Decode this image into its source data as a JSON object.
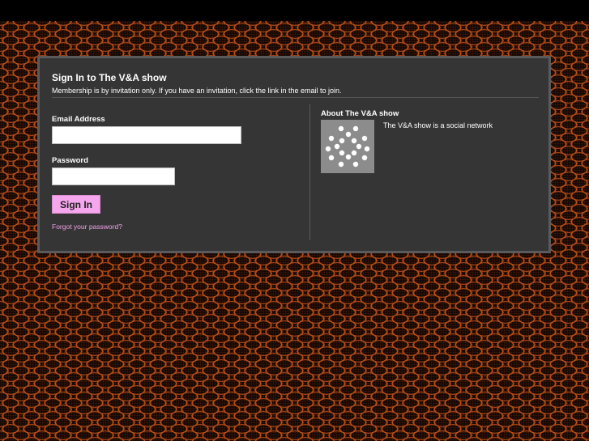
{
  "colors": {
    "background": "#000000",
    "pattern": "#be5019",
    "panel": "#353535",
    "panel_border": "#5a5a5a",
    "button": "#f5a6ec",
    "link": "#f2a0ea"
  },
  "header": {
    "title": "Sign In to The V&A show",
    "subtitle": "Membership is by invitation only. If you have an invitation, click the link in the email to join."
  },
  "form": {
    "email_label": "Email Address",
    "email_value": "",
    "email_placeholder": "",
    "password_label": "Password",
    "password_value": "",
    "password_placeholder": "",
    "signin_label": "Sign In",
    "forgot_label": "Forgot your password?"
  },
  "about": {
    "title": "About The V&A show",
    "image_icon": "network-logo-icon",
    "description": "The V&A show is a social network"
  }
}
